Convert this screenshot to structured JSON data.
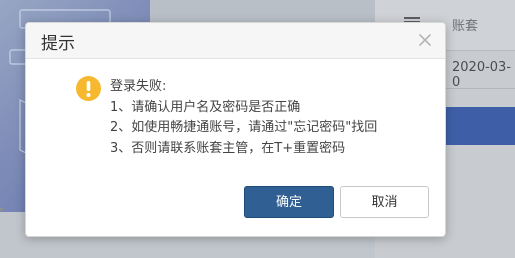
{
  "background": {
    "table_header": "账套",
    "row_date": "2020-03-0"
  },
  "dialog": {
    "title": "提示",
    "close_icon": "close-icon",
    "warning_icon": "exclamation-circle-icon",
    "message_lines": [
      "登录失败:",
      "1、请确认用户名及密码是否正确",
      "2、如使用畅捷通账号，请通过\"忘记密码\"找回",
      "3、否则请联系账套主管，在T+重置密码"
    ],
    "buttons": {
      "confirm_label": "确定",
      "cancel_label": "取消"
    }
  },
  "colors": {
    "primary_button": "#2f5f93",
    "warning_icon": "#f5b82e",
    "selected_row": "#3e5fa8"
  }
}
